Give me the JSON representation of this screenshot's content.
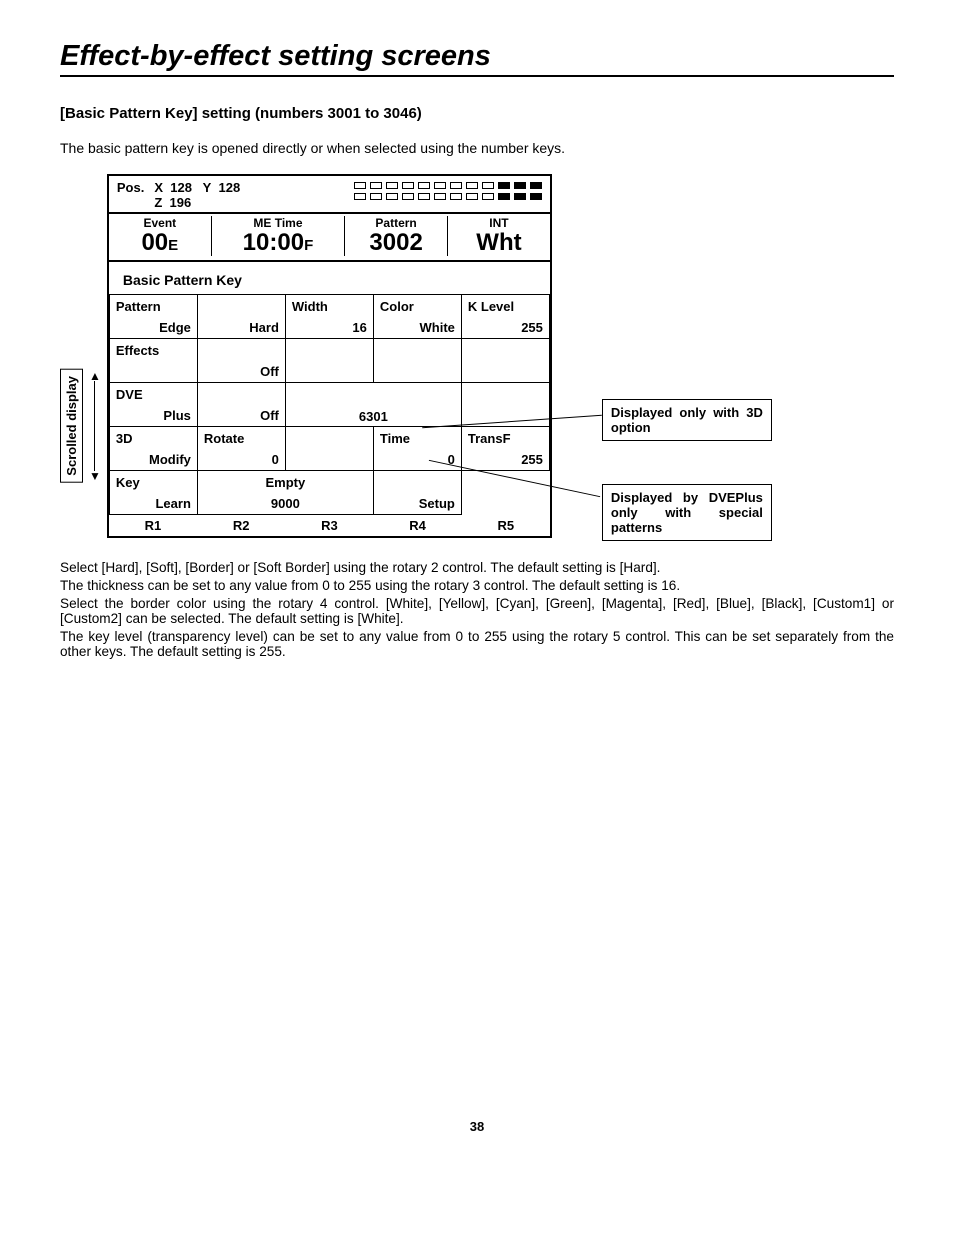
{
  "title": "Effect-by-effect setting screens",
  "subtitle": "[Basic Pattern Key] setting (numbers 3001 to 3046)",
  "intro": "The basic pattern key is opened directly or when selected using the number keys.",
  "scrollLabel": "Scrolled display",
  "pos": {
    "label": "Pos.",
    "xlabel": "X",
    "x": "128",
    "ylabel": "Y",
    "y": "128",
    "zlabel": "Z",
    "z": "196"
  },
  "header": {
    "event": {
      "label": "Event",
      "value": "00",
      "suffix": "E"
    },
    "metime": {
      "label": "ME Time",
      "value": "10:00",
      "suffix": "F"
    },
    "pattern": {
      "label": "Pattern",
      "value": "3002"
    },
    "int": {
      "label": "INT",
      "value": "Wht"
    }
  },
  "sectionHeader": "Basic Pattern Key",
  "rows": [
    {
      "top": [
        "Pattern",
        "",
        "Width",
        "Color",
        "K Level"
      ],
      "bot": [
        "Edge",
        "Hard",
        "16",
        "White",
        "255"
      ]
    },
    {
      "top": [
        "Effects",
        "",
        "",
        "",
        ""
      ],
      "bot": [
        "",
        "Off",
        "",
        "",
        ""
      ]
    },
    {
      "top": [
        "DVE",
        "",
        "",
        "",
        ""
      ],
      "bot": [
        "Plus",
        "Off",
        "",
        "6301",
        ""
      ]
    },
    {
      "top": [
        "3D",
        "Rotate",
        "",
        "Time",
        "TransF"
      ],
      "bot": [
        "Modify",
        "0",
        "",
        "0",
        "255"
      ]
    },
    {
      "top": [
        "Key",
        "Empty",
        "",
        "",
        ""
      ],
      "bot": [
        "Learn",
        "",
        "9000",
        "Setup",
        ""
      ]
    }
  ],
  "rlabels": [
    "R1",
    "R2",
    "R3",
    "R4",
    "R5"
  ],
  "callouts": {
    "c1": "Displayed only with 3D option",
    "c2": "Displayed by DVEPlus only with special patterns"
  },
  "body": [
    "Select [Hard], [Soft], [Border] or [Soft Border] using the rotary 2 control.  The default setting is [Hard].",
    "The thickness can be set to any value from 0 to 255 using the rotary 3 control.  The default setting is 16.",
    "Select the border color using the rotary 4 control.  [White], [Yellow], [Cyan], [Green], [Magenta], [Red], [Blue], [Black], [Custom1] or [Custom2] can be selected.  The default setting is [White].",
    "The key level (transparency level) can be set to any value from 0 to 255 using the rotary 5 control.  This can be set separately from the other keys.  The default setting is 255."
  ],
  "pageNum": "38"
}
